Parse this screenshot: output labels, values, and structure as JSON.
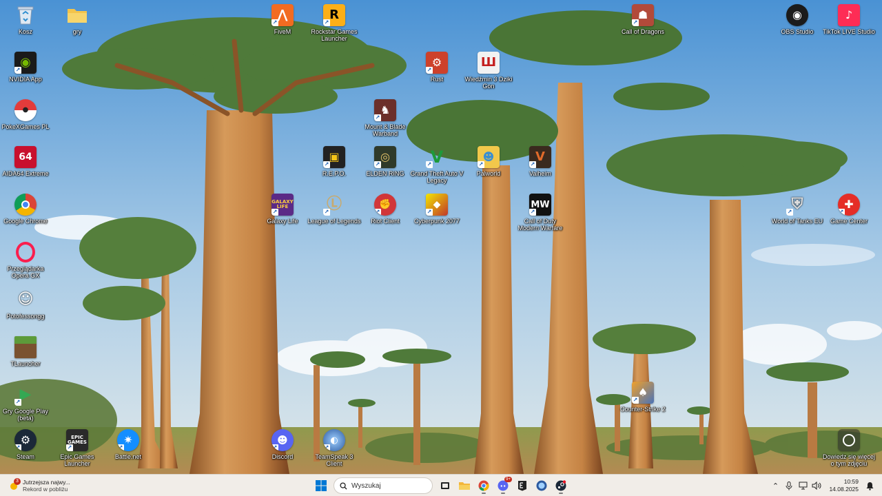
{
  "desktop": {
    "icons": [
      {
        "id": "kosz",
        "label": "Kosz"
      },
      {
        "id": "gry",
        "label": "gry"
      },
      {
        "id": "fivem",
        "label": "FiveM"
      },
      {
        "id": "rockstar",
        "label": "Rockstar Games Launcher"
      },
      {
        "id": "call-of-dragons",
        "label": "Call of Dragons"
      },
      {
        "id": "obs",
        "label": "OBS Studio"
      },
      {
        "id": "tiktok-live",
        "label": "TikTok LIVE Studio"
      },
      {
        "id": "nvidia",
        "label": "NVIDIA App"
      },
      {
        "id": "rust",
        "label": "Rust"
      },
      {
        "id": "wiedzmin",
        "label": "Wiedźmin 3 Dziki Gon"
      },
      {
        "id": "pokexgames",
        "label": "PokeXGames PL"
      },
      {
        "id": "mount-blade",
        "label": "Mount & Blade Warband"
      },
      {
        "id": "aida64",
        "label": "AIDA64 Extreme"
      },
      {
        "id": "repo",
        "label": "R.E.P.O."
      },
      {
        "id": "elden-ring",
        "label": "ELDEN RING"
      },
      {
        "id": "gta5",
        "label": "Grand Theft Auto V Legacy"
      },
      {
        "id": "palworld",
        "label": "Palworld"
      },
      {
        "id": "valheim",
        "label": "Valheim"
      },
      {
        "id": "chrome",
        "label": "Google Chrome"
      },
      {
        "id": "galaxy-life",
        "label": "Galaxy Life"
      },
      {
        "id": "lol",
        "label": "League of Legends"
      },
      {
        "id": "riot",
        "label": "Riot Client"
      },
      {
        "id": "cyberpunk",
        "label": "Cyberpunk 2077"
      },
      {
        "id": "cod-mw",
        "label": "Call of Duty Modern Warfare"
      },
      {
        "id": "wot",
        "label": "World of Tanks EU"
      },
      {
        "id": "game-center",
        "label": "Game Center"
      },
      {
        "id": "opera-gx",
        "label": "Przeglądarka Opera GX"
      },
      {
        "id": "potofessongg",
        "label": "Potofessongg"
      },
      {
        "id": "tlauncher",
        "label": "TLauncher"
      },
      {
        "id": "google-play-games",
        "label": "Gry Google Play (beta)"
      },
      {
        "id": "cs2",
        "label": "Counter-Strike 2"
      },
      {
        "id": "steam",
        "label": "Steam"
      },
      {
        "id": "epic",
        "label": "Epic Games Launcher"
      },
      {
        "id": "battlenet",
        "label": "Battle.net"
      },
      {
        "id": "discord",
        "label": "Discord"
      },
      {
        "id": "teamspeak",
        "label": "TeamSpeak 3 Client"
      },
      {
        "id": "spotlight",
        "label": "Dowiedz się więcej o tym zdjęciu"
      }
    ],
    "icon_glyphs": {
      "epic": "EPIC GAMES",
      "aida64": "64",
      "cod-mw": "MW",
      "galaxy-life": "GALAXY LIFE"
    }
  },
  "taskbar": {
    "weather": {
      "badge": "3",
      "line1": "Jutrzejsza najwy...",
      "line2": "Rekord w pobliżu"
    },
    "search_placeholder": "Wyszukaj",
    "pinned": [
      "file-explorer-icon",
      "chrome-icon",
      "discord-icon",
      "epic-games-icon",
      "teamspeak-icon",
      "steam-icon"
    ],
    "discord_badge": "9+",
    "clock": {
      "time": "10:59",
      "date": "14.08.2025"
    }
  },
  "colors": {
    "taskbar_bg": "#f1ede8",
    "sky_top": "#4f95d6",
    "sky_bottom": "#cfe3ef",
    "trunk": "#c9874a",
    "foliage": "#4f7a3a"
  }
}
